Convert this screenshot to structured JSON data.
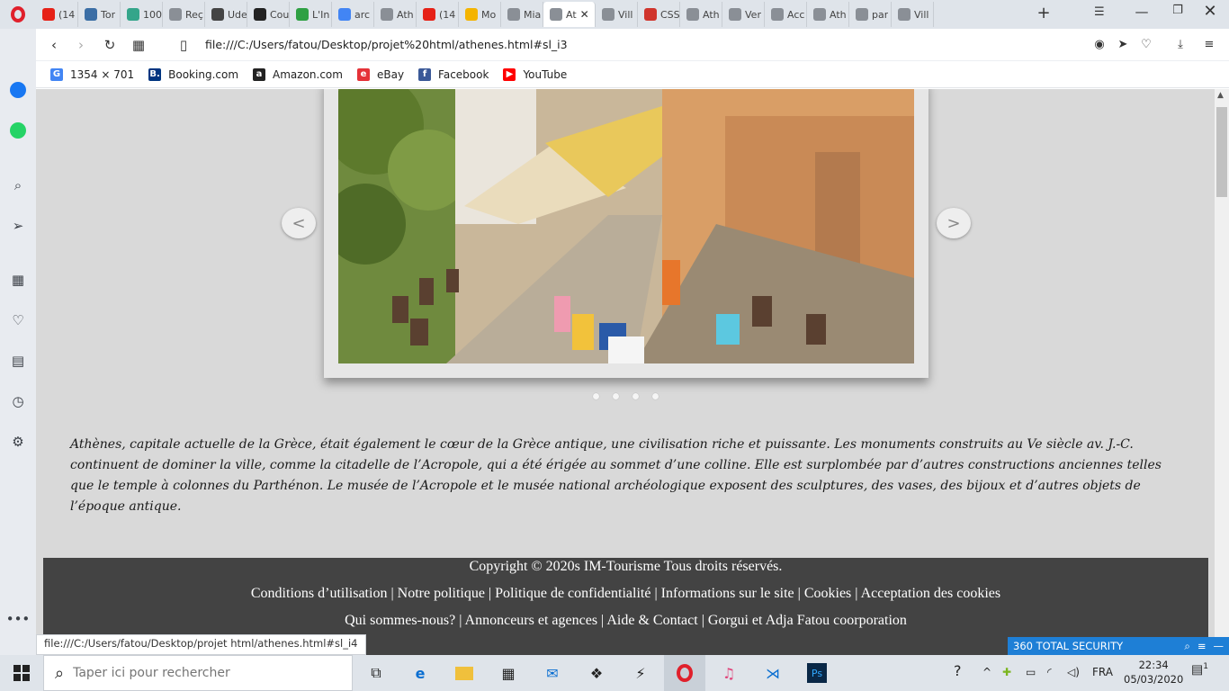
{
  "browser": {
    "tabs": [
      {
        "label": "(14",
        "icon": "youtube-icon",
        "color": "#e62117"
      },
      {
        "label": "Tor",
        "icon": "tg-icon",
        "color": "#3b6ea5"
      },
      {
        "label": "100",
        "icon": "d-icon",
        "color": "#34a58a"
      },
      {
        "label": "Reç",
        "icon": "page-icon",
        "color": "#8a8f96"
      },
      {
        "label": "Ude",
        "icon": "udemy-icon",
        "color": "#444444"
      },
      {
        "label": "Cou",
        "icon": "codepen-icon",
        "color": "#222222"
      },
      {
        "label": "L'In",
        "icon": "px-icon",
        "color": "#2ea043"
      },
      {
        "label": "arc",
        "icon": "google-icon",
        "color": "#4285f4"
      },
      {
        "label": "Ath",
        "icon": "page-icon",
        "color": "#8a8f96"
      },
      {
        "label": "(14",
        "icon": "youtube-icon",
        "color": "#e62117"
      },
      {
        "label": "Mo",
        "icon": "drive-icon",
        "color": "#f4b400"
      },
      {
        "label": "Mia",
        "icon": "page-icon",
        "color": "#8a8f96"
      },
      {
        "label": "At",
        "icon": "page-icon",
        "color": "#8a8f96",
        "active": true
      },
      {
        "label": "Vill",
        "icon": "page-icon",
        "color": "#8a8f96"
      },
      {
        "label": "CSS",
        "icon": "css-icon",
        "color": "#d0342c"
      },
      {
        "label": "Ath",
        "icon": "page-icon",
        "color": "#8a8f96"
      },
      {
        "label": "Ver",
        "icon": "page-icon",
        "color": "#8a8f96"
      },
      {
        "label": "Acc",
        "icon": "grid-icon",
        "color": "#8a8f96"
      },
      {
        "label": "Ath",
        "icon": "page-icon",
        "color": "#8a8f96"
      },
      {
        "label": "par",
        "icon": "page-icon",
        "color": "#8a8f96"
      },
      {
        "label": "Vill",
        "icon": "page-icon",
        "color": "#8a8f96"
      }
    ],
    "new_tab": "+",
    "url": "file:///C:/Users/fatou/Desktop/projet%20html/athenes.html#sl_i3",
    "bookmarks": [
      {
        "label": "1354 × 701",
        "icon": "google-icon",
        "color": "#4285f4",
        "glyph": "G"
      },
      {
        "label": "Booking.com",
        "icon": "booking-icon",
        "color": "#003580",
        "glyph": "B."
      },
      {
        "label": "Amazon.com",
        "icon": "amazon-icon",
        "color": "#222222",
        "glyph": "a"
      },
      {
        "label": "eBay",
        "icon": "ebay-icon",
        "color": "#e53238",
        "glyph": "e"
      },
      {
        "label": "Facebook",
        "icon": "facebook-icon",
        "color": "#3b5998",
        "glyph": "f"
      },
      {
        "label": "YouTube",
        "icon": "youtube-icon",
        "color": "#ff0000",
        "glyph": "▶"
      }
    ],
    "status_url": "file:///C:/Users/fatou/Desktop/projet html/athenes.html#sl_i4"
  },
  "slider": {
    "prev_label": "<",
    "next_label": ">",
    "dots": [
      1,
      2,
      3,
      4
    ],
    "current_slide": 3
  },
  "article": {
    "text": "Athènes, capitale actuelle de la Grèce, était également le cœur de la Grèce antique, une civilisation riche et puissante. Les monuments construits au Ve siècle av. J.-C. continuent de dominer la ville, comme la citadelle de l’Acropole, qui a été érigée au sommet d’une colline. Elle est surplombée par d’autres constructions anciennes telles que le temple à colonnes du Parthénon. Le musée de l’Acropole et le musée national archéologique exposent des sculptures, des vases, des bijoux et d’autres objets de l’époque antique."
  },
  "footer": {
    "copyright": "Copyright © 2020s IM-Tourisme Tous droits réservés.",
    "row2": [
      "Conditions d’utilisation",
      "Notre politique",
      "Politique de confidentialité",
      "Informations sur le site",
      "Cookies",
      "Acceptation des cookies"
    ],
    "row3": [
      "Qui sommes-nous?",
      "Annonceurs et agences",
      "Aide & Contact",
      "Gorgui et Adja Fatou coorporation"
    ],
    "separator": " | "
  },
  "security_widget": {
    "label": "360 TOTAL SECURITY",
    "color": "#1e7fd6"
  },
  "taskbar": {
    "search_placeholder": "Taper ici pour rechercher",
    "language": "FRA",
    "time": "22:34",
    "date": "05/03/2020",
    "notification_count": "1"
  }
}
